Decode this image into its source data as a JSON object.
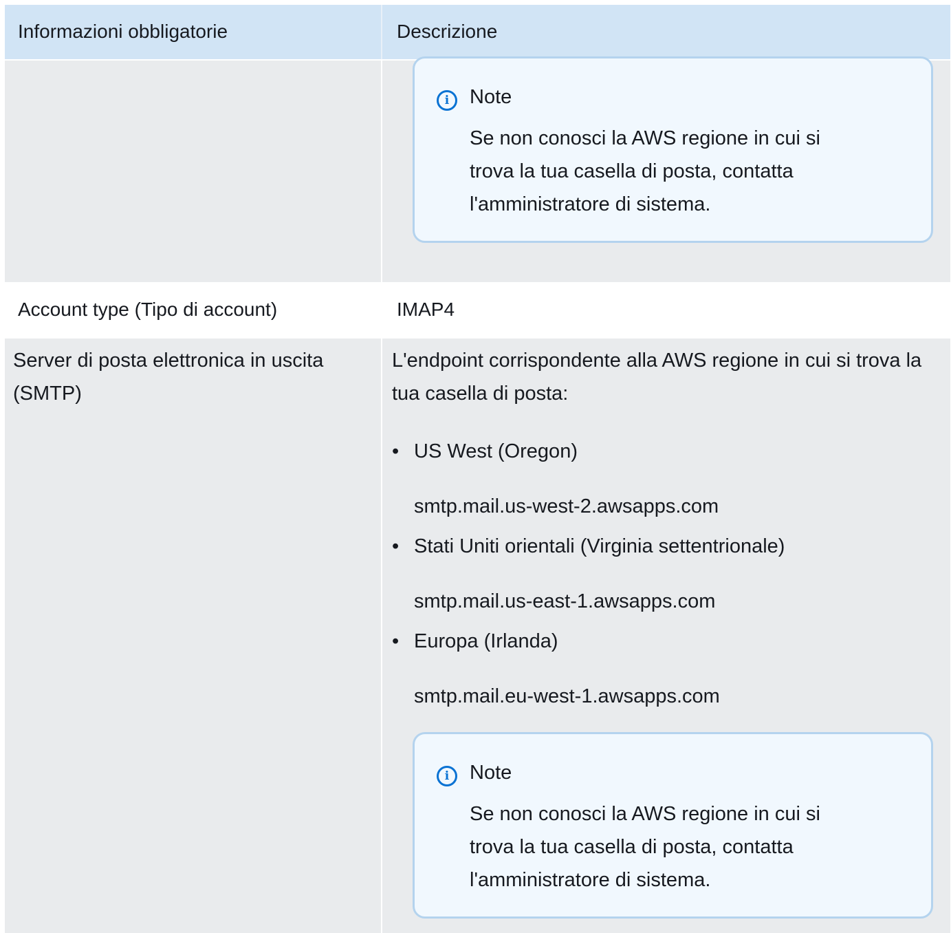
{
  "table": {
    "headers": {
      "col1": "Informazioni obbligatorie",
      "col2": "Descrizione"
    },
    "note_top": {
      "icon": "info-icon",
      "title": "Note",
      "text": "Se non conosci la AWS regione in cui si trova la tua casella di posta, contatta l'amministratore di sistema."
    },
    "account_type": {
      "label": "Account type (Tipo di account)",
      "value": "IMAP4"
    },
    "smtp": {
      "label": "Server di posta elettronica in uscita (SMTP)",
      "description": "L'endpoint corrispondente alla AWS regione in cui si trova la tua casella di posta:",
      "regions": [
        {
          "name": "US West (Oregon)",
          "endpoint": "smtp.mail.us-west-2.awsapps.com"
        },
        {
          "name": "Stati Uniti orientali (Virginia settentrionale)",
          "endpoint": "smtp.mail.us-east-1.awsapps.com"
        },
        {
          "name": "Europa (Irlanda)",
          "endpoint": "smtp.mail.eu-west-1.awsapps.com"
        }
      ],
      "bullet": "•",
      "note": {
        "icon": "info-icon",
        "title": "Note",
        "text": "Se non conosci la AWS regione in cui si trova la tua casella di posta, contatta l'amministratore di sistema."
      }
    }
  },
  "colors": {
    "header_bg": "#d1e4f5",
    "row_gray": "#e9ebed",
    "note_border": "#b4d3ee",
    "note_bg": "#f1f8fe",
    "info_blue": "#0972d3"
  }
}
